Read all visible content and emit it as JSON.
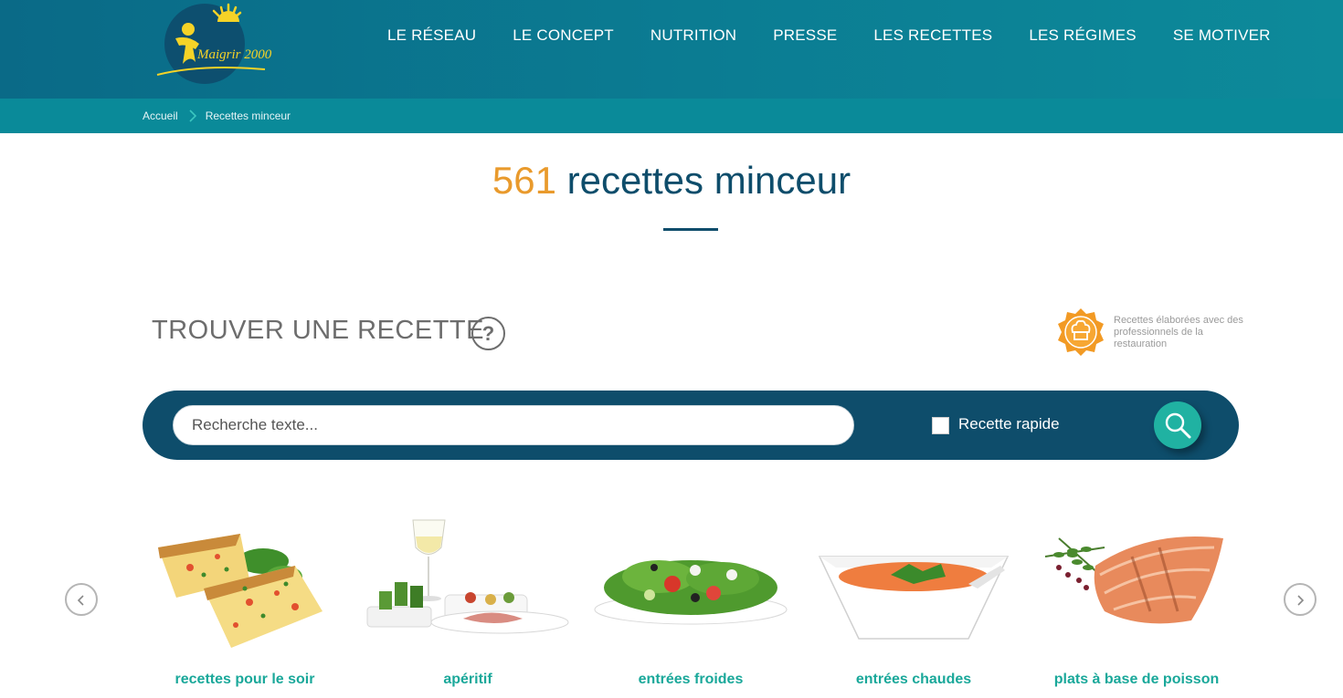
{
  "header": {
    "logo_text": "Maigrir 2000",
    "nav": [
      "LE RÉSEAU",
      "LE CONCEPT",
      "NUTRITION",
      "PRESSE",
      "LES RECETTES",
      "LES RÉGIMES",
      "SE MOTIVER"
    ]
  },
  "breadcrumb": {
    "home": "Accueil",
    "current": "Recettes minceur"
  },
  "title": {
    "count": "561",
    "text": "recettes minceur"
  },
  "find": {
    "heading": "TROUVER UNE RECETTE",
    "help": "?",
    "pro_note": "Recettes élaborées avec des professionnels de la restauration"
  },
  "search": {
    "placeholder": "Recherche texte...",
    "value": "",
    "quick_label": "Recette rapide",
    "quick_checked": false
  },
  "categories": [
    {
      "label": "recettes pour le soir",
      "icon": "quiche-image"
    },
    {
      "label": "apéritif",
      "icon": "aperitif-image"
    },
    {
      "label": "entrées froides",
      "icon": "salad-image"
    },
    {
      "label": "entrées chaudes",
      "icon": "soup-image"
    },
    {
      "label": "plats à base de poisson",
      "icon": "salmon-image"
    }
  ],
  "colors": {
    "header_bg": "#0a6a87",
    "breadcrumb_bg": "#0a8a99",
    "title_text": "#0e4d6b",
    "count_accent": "#e99a2c",
    "search_bar_bg": "#0e4d6b",
    "search_button": "#20b2a2",
    "category_text": "#1aa89a"
  }
}
